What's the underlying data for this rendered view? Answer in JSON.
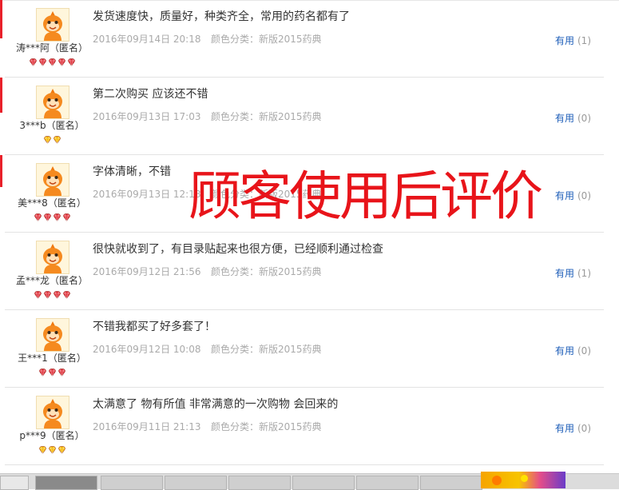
{
  "useful_label": "有用",
  "overlay_text": "顾客使用后评价",
  "reviews": [
    {
      "user": "涛***阿",
      "anon": "（匿名）",
      "level": "red",
      "gems": 5,
      "text": "发货速度快，质量好，种类齐全，常用的药名都有了",
      "date": "2016年09月14日 20:18",
      "category": "颜色分类：新版2015药典",
      "useful_count": "(1)"
    },
    {
      "user": "3***b",
      "anon": "（匿名）",
      "level": "gold",
      "gems": 2,
      "text": "第二次购买 应该还不错",
      "date": "2016年09月13日 17:03",
      "category": "颜色分类：新版2015药典",
      "useful_count": "(0)"
    },
    {
      "user": "美***8",
      "anon": "（匿名）",
      "level": "red",
      "gems": 4,
      "text": "字体清晰，不错",
      "date": "2016年09月13日 12:18",
      "category": "颜色分类：新版2015药典",
      "useful_count": "(0)"
    },
    {
      "user": "孟***龙",
      "anon": "（匿名）",
      "level": "red",
      "gems": 4,
      "text": "很快就收到了，有目录贴起来也很方便，已经顺利通过检查",
      "date": "2016年09月12日 21:56",
      "category": "颜色分类：新版2015药典",
      "useful_count": "(1)"
    },
    {
      "user": "王***1",
      "anon": "（匿名）",
      "level": "red",
      "gems": 3,
      "text": "不错我都买了好多套了！",
      "date": "2016年09月12日 10:08",
      "category": "颜色分类：新版2015药典",
      "useful_count": "(0)"
    },
    {
      "user": "p***9",
      "anon": "（匿名）",
      "level": "gold",
      "gems": 3,
      "text": "太满意了 物有所值 非常满意的一次购物 会回来的",
      "date": "2016年09月11日 21:13",
      "category": "颜色分类：新版2015药典",
      "useful_count": "(0)"
    }
  ],
  "colors": {
    "overlay": "#e8141a",
    "useful_link": "#1c5db8",
    "red_gem": "#e0303a",
    "gold_gem": "#f5b800",
    "meta_text": "#aaaaaa"
  }
}
